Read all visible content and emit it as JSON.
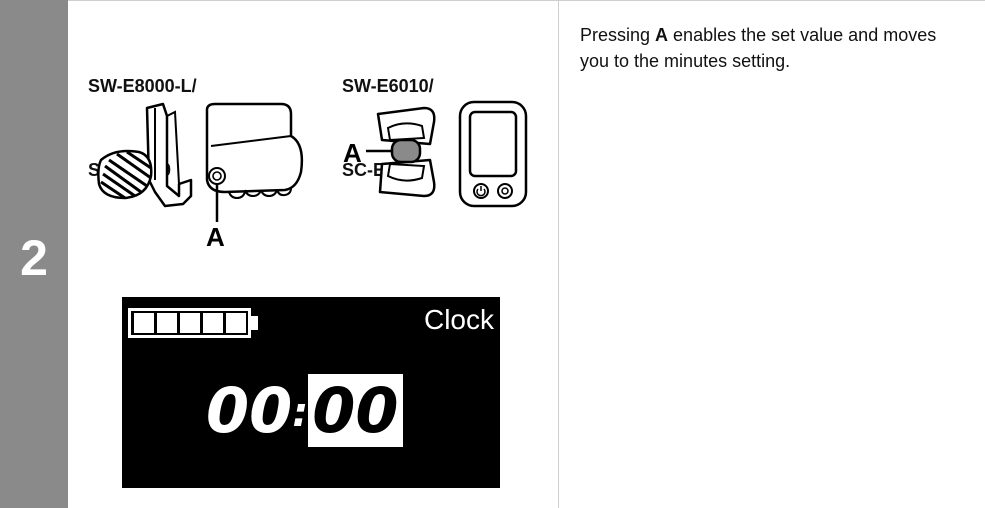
{
  "step": {
    "number": "2"
  },
  "models": {
    "left_line1": "SW-E8000-L/",
    "left_line2": "SC-E8000",
    "right_line1": "SW-E6010/",
    "right_line2": "SC-E6010"
  },
  "callouts": {
    "left": "A",
    "right": "A"
  },
  "instruction": {
    "pre": "Pressing ",
    "key": "A",
    "post": " enables the set value and moves you to the minutes setting."
  },
  "display": {
    "mode_label": "Clock",
    "hours": "00",
    "separator": ":",
    "minutes": "00",
    "battery_segments_filled": 5,
    "battery_segments_total": 5
  }
}
